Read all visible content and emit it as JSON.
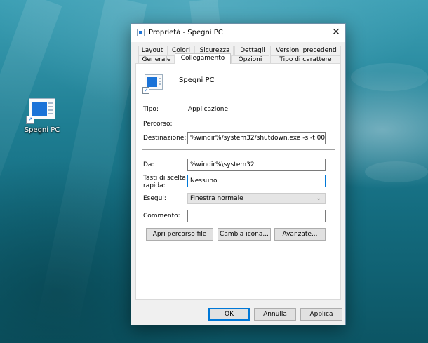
{
  "desktop": {
    "icon_label": "Spegni PC"
  },
  "dialog": {
    "title": "Proprietà - Spegni PC",
    "tabs_row1": [
      "Layout",
      "Colori",
      "Sicurezza",
      "Dettagli",
      "Versioni precedenti"
    ],
    "tabs_row2": [
      "Generale",
      "Collegamento",
      "Opzioni",
      "Tipo di carattere"
    ],
    "active_tab": "Collegamento",
    "shortcut_name": "Spegni PC",
    "fields": {
      "tipo_label": "Tipo:",
      "tipo_value": "Applicazione",
      "percorso_label": "Percorso:",
      "destinazione_label": "Destinazione:",
      "destinazione_value": "%windir%/system32/shutdown.exe -s -t 00",
      "da_label": "Da:",
      "da_value": "%windir%\\system32",
      "tasti_label_line1": "Tasti di scelta",
      "tasti_label_line2": "rapida:",
      "tasti_value": "Nessuno",
      "esegui_label": "Esegui:",
      "esegui_value": "Finestra normale",
      "commento_label": "Commento:",
      "commento_value": ""
    },
    "buttons": {
      "apri_percorso": "Apri percorso file",
      "cambia_icona": "Cambia icona...",
      "avanzate": "Avanzate...",
      "ok": "OK",
      "annulla": "Annulla",
      "applica": "Applica"
    },
    "colors": {
      "accent": "#0078d7",
      "shortcut_blue": "#1b73d8"
    }
  }
}
